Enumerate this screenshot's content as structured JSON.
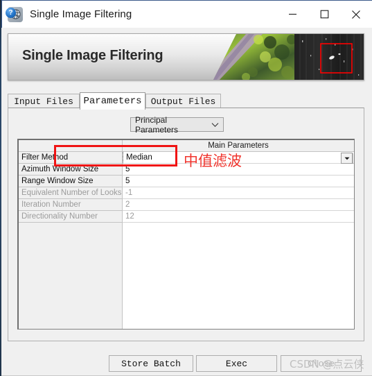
{
  "window": {
    "title": "Single Image Filtering",
    "icon": "globe-icon",
    "controls": {
      "minimize": "minimize-icon",
      "maximize": "maximize-icon",
      "close": "close-icon"
    }
  },
  "banner": {
    "title": "Single Image Filtering",
    "artwork": "aerial-sar-image-pair",
    "highlight_color": "#ff0000"
  },
  "tabs": [
    {
      "label": "Input Files",
      "active": false
    },
    {
      "label": "Parameters",
      "active": true
    },
    {
      "label": "Output Files",
      "active": false
    }
  ],
  "mode_select": {
    "value": "Principal Parameters",
    "icon": "chevron-down-icon"
  },
  "table": {
    "header_left": "",
    "header_right": "Main Parameters",
    "rows": [
      {
        "name": "Filter Method",
        "value": "Median",
        "disabled": false,
        "selected": true,
        "has_combo": true
      },
      {
        "name": "Azimuth Window Size",
        "value": "5",
        "disabled": false,
        "selected": false,
        "has_combo": false
      },
      {
        "name": "Range Window Size",
        "value": "5",
        "disabled": false,
        "selected": false,
        "has_combo": false
      },
      {
        "name": "Equivalent Number of Looks",
        "value": "-1",
        "disabled": true,
        "selected": false,
        "has_combo": false
      },
      {
        "name": "Iteration Number",
        "value": "2",
        "disabled": true,
        "selected": false,
        "has_combo": false
      },
      {
        "name": "Directionality Number",
        "value": "12",
        "disabled": true,
        "selected": false,
        "has_combo": false
      }
    ]
  },
  "annotation": {
    "box_color": "#f01414",
    "text": "中值滤波",
    "text_color": "#f0332c"
  },
  "footer": {
    "help_icon": "?",
    "buttons": {
      "store_batch": "Store Batch",
      "exec": "Exec",
      "close": "Close"
    }
  },
  "watermark": {
    "text": "CSDN @点云侠"
  }
}
